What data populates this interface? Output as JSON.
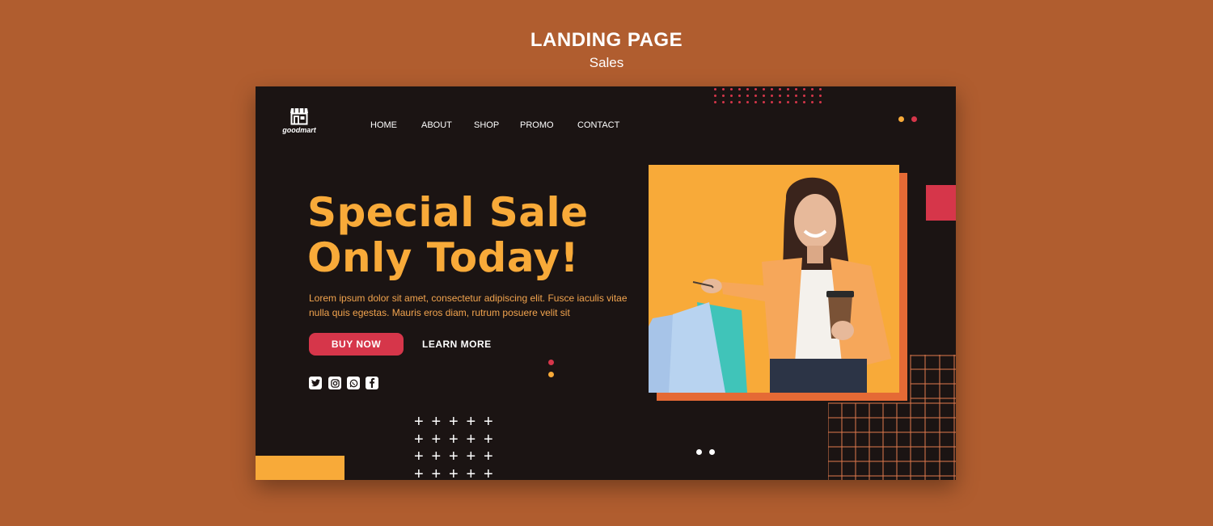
{
  "page_heading": {
    "title": "LANDING PAGE",
    "subtitle": "Sales"
  },
  "brand": {
    "name": "goodmart"
  },
  "nav": [
    {
      "label": "HOME"
    },
    {
      "label": "ABOUT"
    },
    {
      "label": "SHOP"
    },
    {
      "label": "PROMO"
    },
    {
      "label": "CONTACT"
    }
  ],
  "hero": {
    "headline_line1": "Special Sale",
    "headline_line2": "Only Today!",
    "body": "Lorem ipsum dolor sit amet, consectetur adipiscing elit. Fusce iaculis vitae nulla quis egestas. Mauris eros diam, rutrum posuere velit sit",
    "buy_label": "BUY NOW",
    "learn_label": "LEARN MORE"
  },
  "social_icons": [
    "twitter-icon",
    "instagram-icon",
    "whatsapp-icon",
    "facebook-icon"
  ],
  "colors": {
    "background": "#b05d2f",
    "panel": "#1b1413",
    "accent_yellow": "#f8aa39",
    "accent_red": "#d6364a",
    "accent_orange": "#e56a35"
  }
}
